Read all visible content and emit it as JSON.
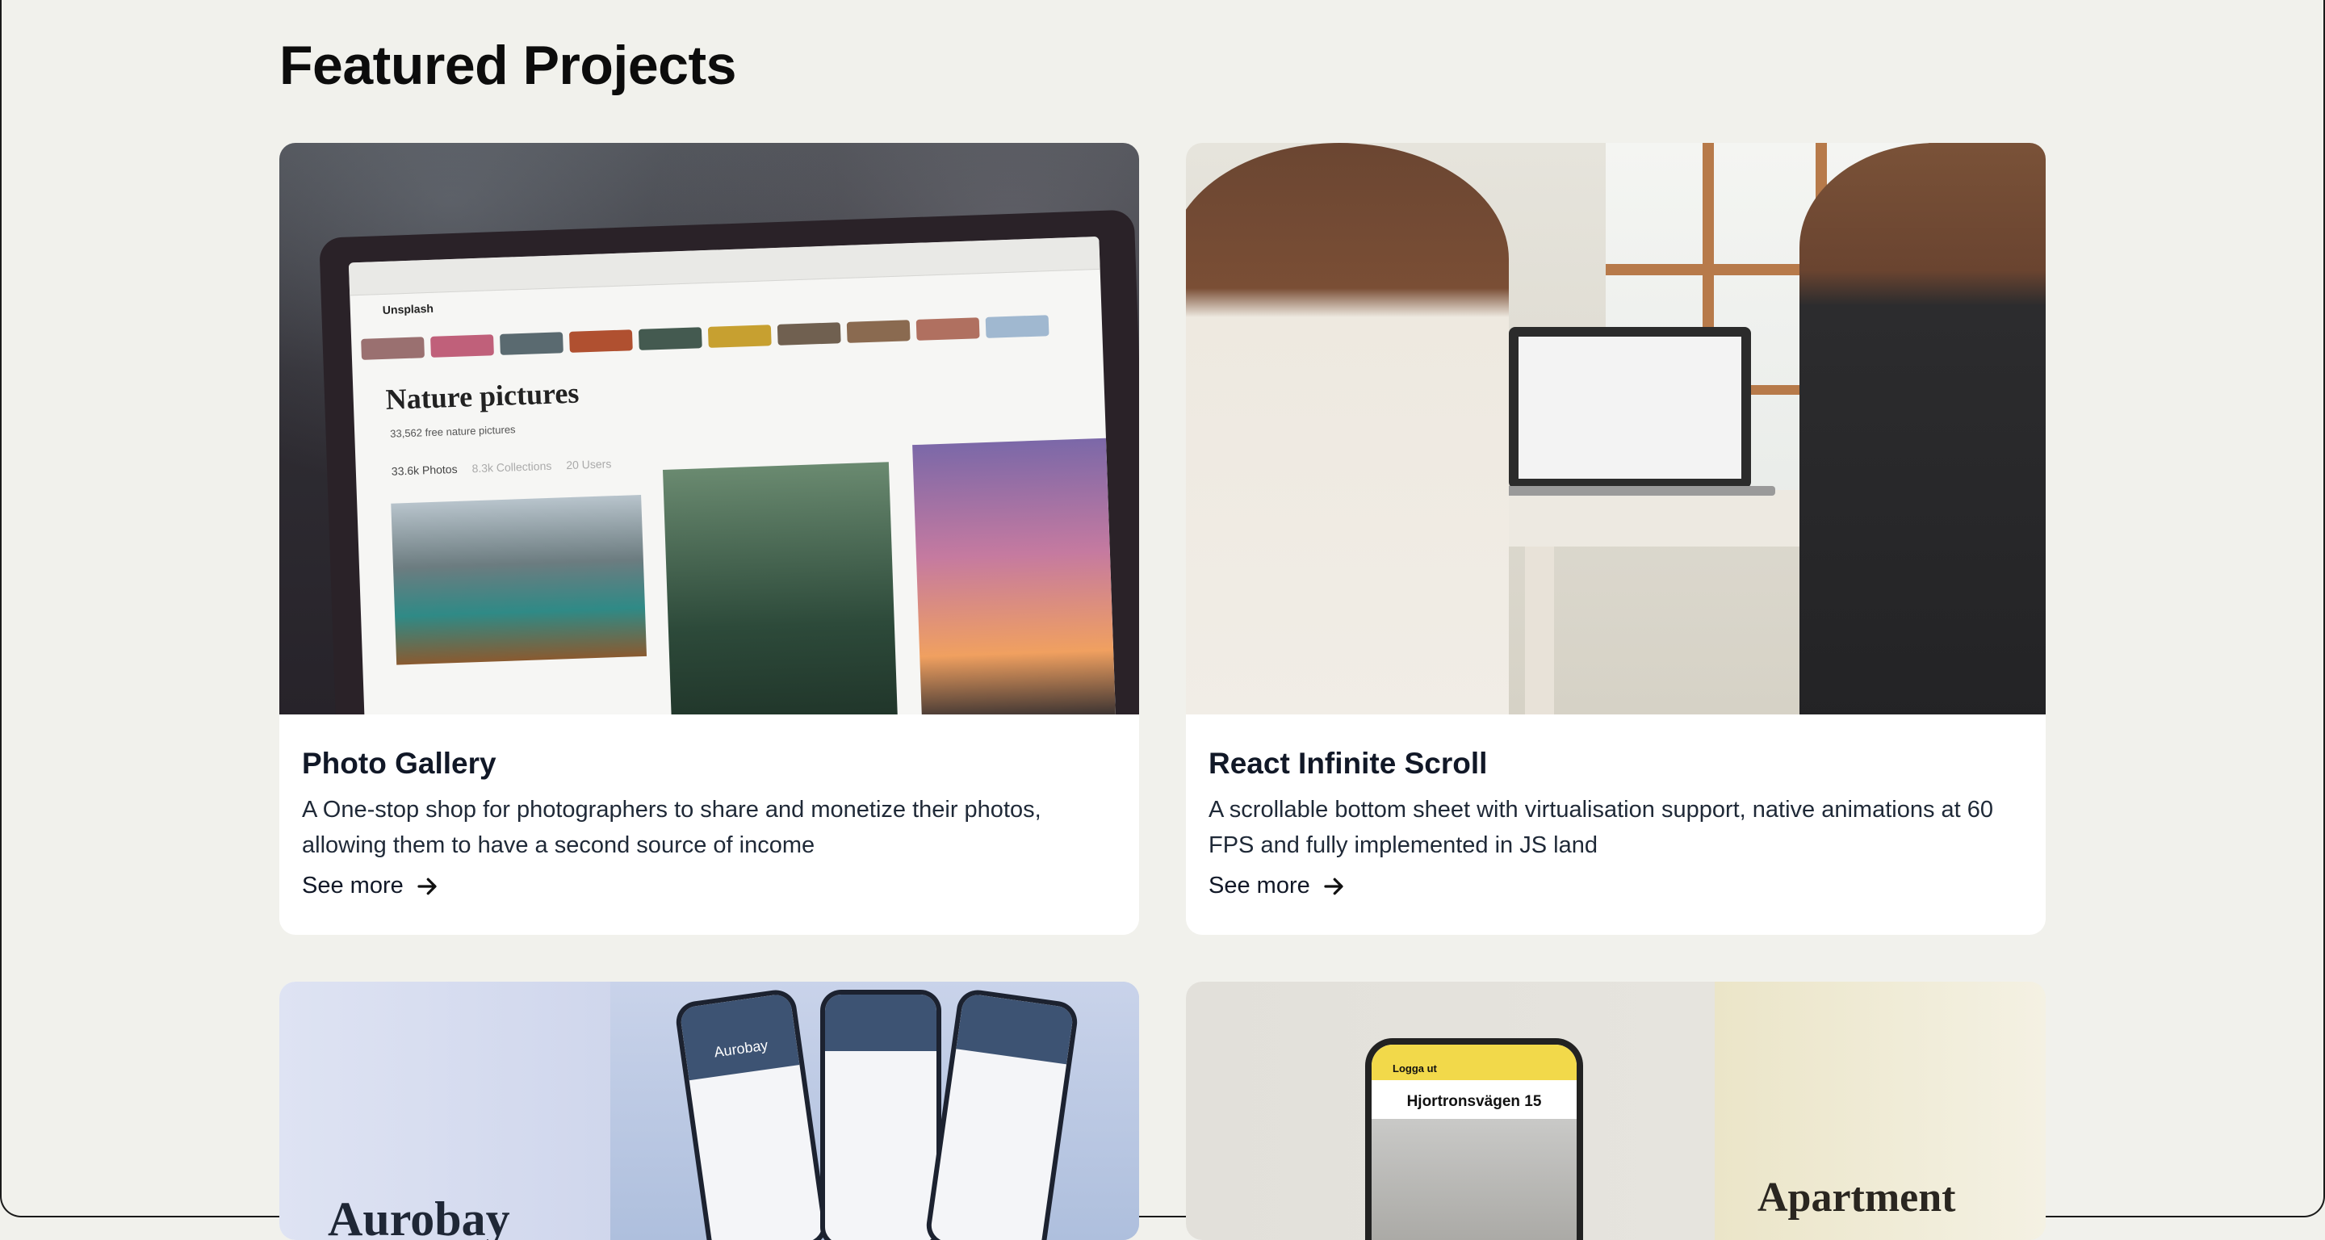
{
  "page": {
    "heading": "Featured Projects"
  },
  "projects": [
    {
      "title": "Photo Gallery",
      "description": "A One-stop shop for photographers to share and monetize their photos, allowing them to have a second source of income",
      "link_label": "See more",
      "image": {
        "heading": "Nature pictures",
        "subtext": "33,562 free nature pictures",
        "tab_photos": "33.6k Photos",
        "tab_collections": "8.3k Collections",
        "tab_users": "20 Users",
        "site_name": "Unsplash"
      }
    },
    {
      "title": "React Infinite Scroll",
      "description": "A scrollable bottom sheet with virtualisation support, native animations at 60 FPS and fully implemented in JS land",
      "link_label": "See more"
    },
    {
      "image": {
        "brand": "Aurobay",
        "phone_title": "Aurobay"
      }
    },
    {
      "image": {
        "top_label": "Logga ut",
        "address": "Hjortronsvägen 15",
        "caption": "Apartment"
      }
    }
  ],
  "colors": {
    "background": "#f1f1ec",
    "card": "#ffffff",
    "text": "#111827"
  },
  "icons": {
    "see_more": "arrow-right-icon"
  }
}
